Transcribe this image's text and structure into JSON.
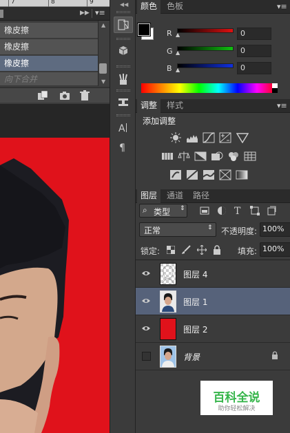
{
  "ruler": {
    "marks": [
      "7",
      "8",
      "9"
    ]
  },
  "history": {
    "rows": [
      {
        "label": "橡皮擦",
        "selected": false,
        "disabled": false
      },
      {
        "label": "橡皮擦",
        "selected": false,
        "disabled": false
      },
      {
        "label": "橡皮擦",
        "selected": true,
        "disabled": false
      },
      {
        "label": "向下合并",
        "selected": false,
        "disabled": true
      }
    ]
  },
  "color_panel": {
    "tabs": [
      "颜色",
      "色板"
    ],
    "active_tab": "颜色",
    "channels": [
      {
        "label": "R",
        "value": "0",
        "color": "#e01010"
      },
      {
        "label": "G",
        "value": "0",
        "color": "#10c010"
      },
      {
        "label": "B",
        "value": "0",
        "color": "#1030e0"
      }
    ]
  },
  "adjust_panel": {
    "tabs": [
      "调整",
      "样式"
    ],
    "active_tab": "调整",
    "title": "添加调整"
  },
  "layers_panel": {
    "tabs": [
      "图层",
      "通道",
      "路径"
    ],
    "active_tab": "图层",
    "filter_kind": "类型",
    "blend_mode": "正常",
    "opacity_label": "不透明度:",
    "opacity_value": "100%",
    "lock_label": "锁定:",
    "fill_label": "填充:",
    "fill_value": "100%",
    "layers": [
      {
        "name": "图层 4",
        "visible": true,
        "selected": false,
        "thumb": "transparent"
      },
      {
        "name": "图层 1",
        "visible": true,
        "selected": true,
        "thumb": "photo"
      },
      {
        "name": "图层 2",
        "visible": true,
        "selected": false,
        "thumb": "red"
      },
      {
        "name": "背景",
        "visible": false,
        "selected": false,
        "thumb": "photo-blue",
        "locked": true
      }
    ]
  },
  "watermark": {
    "title": "百科全说",
    "subtitle": "助你轻松解决"
  }
}
